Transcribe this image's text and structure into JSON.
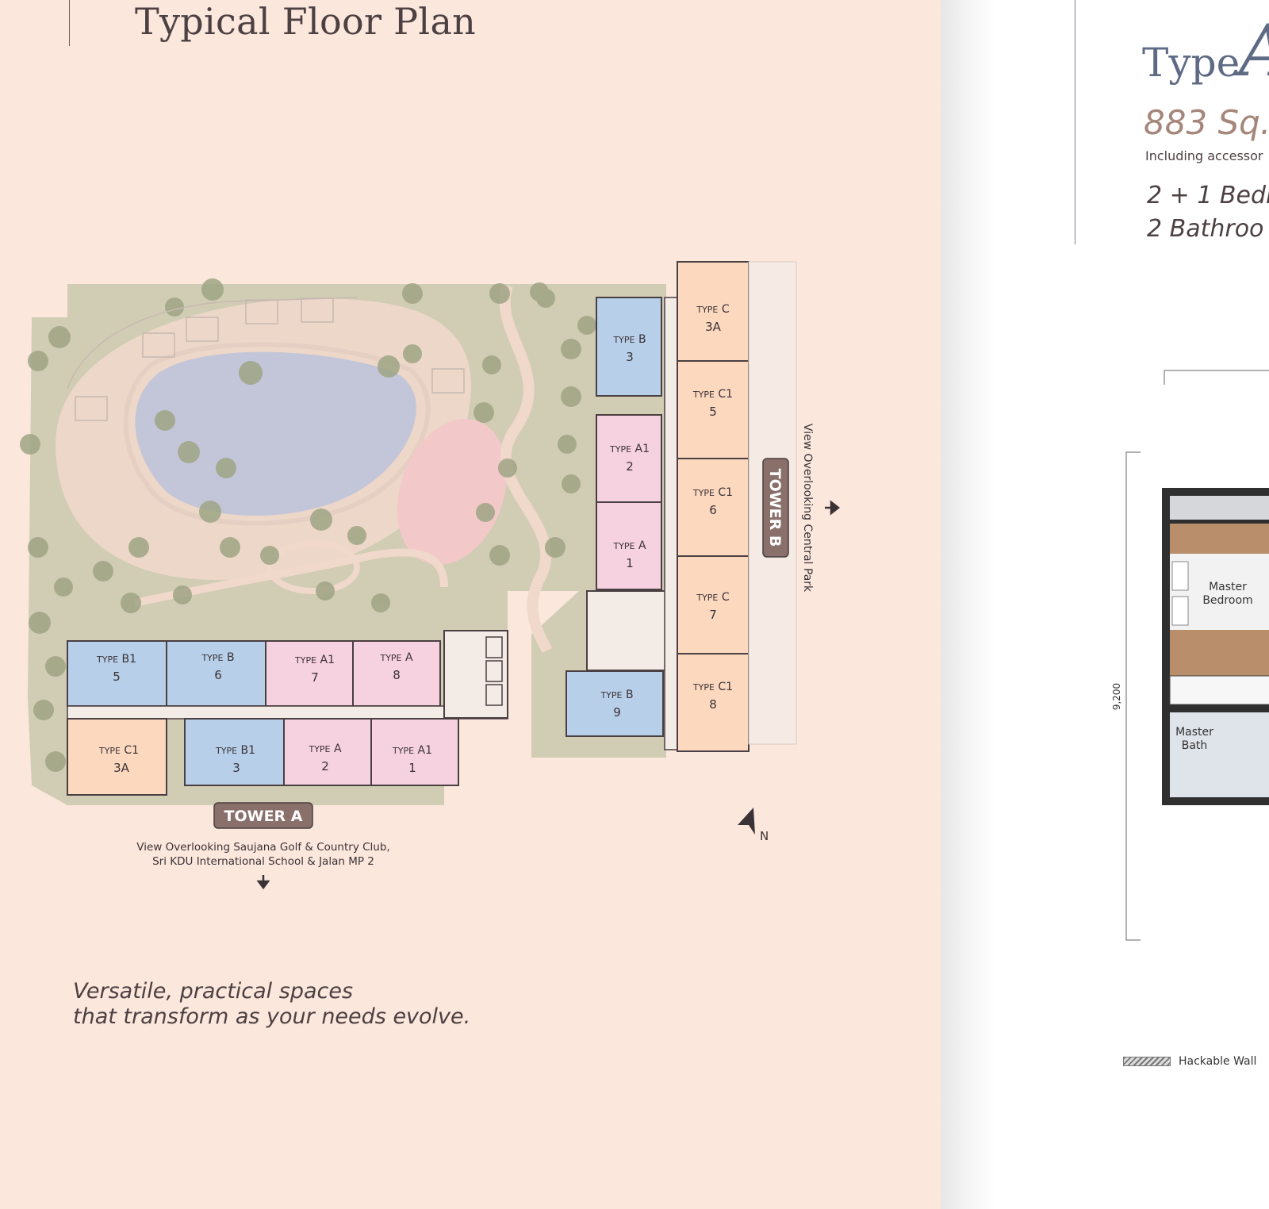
{
  "left_page": {
    "title": "Typical Floor Plan",
    "tagline_line1": "Versatile, practical spaces",
    "tagline_line2": "that transform as your needs evolve."
  },
  "site_plan": {
    "tower_a": {
      "label": "TOWER A",
      "view_line1": "View Overlooking Saujana Golf & Country Club,",
      "view_line2": "Sri KDU International School & Jalan MP 2"
    },
    "tower_b": {
      "label": "TOWER B",
      "view": "View Overlooking Central Park"
    },
    "north_label": "N",
    "units": [
      {
        "type_small": "TYPE",
        "type_big": "C",
        "no": "3A"
      },
      {
        "type_small": "TYPE",
        "type_big": "C1",
        "no": "5"
      },
      {
        "type_small": "TYPE",
        "type_big": "C1",
        "no": "6"
      },
      {
        "type_small": "TYPE",
        "type_big": "C",
        "no": "7"
      },
      {
        "type_small": "TYPE",
        "type_big": "C1",
        "no": "8"
      },
      {
        "type_small": "TYPE",
        "type_big": "B",
        "no": "3"
      },
      {
        "type_small": "TYPE",
        "type_big": "A1",
        "no": "2"
      },
      {
        "type_small": "TYPE",
        "type_big": "A",
        "no": "1"
      },
      {
        "type_small": "TYPE",
        "type_big": "B",
        "no": "9"
      },
      {
        "type_small": "TYPE",
        "type_big": "B1",
        "no": "5"
      },
      {
        "type_small": "TYPE",
        "type_big": "B",
        "no": "6"
      },
      {
        "type_small": "TYPE",
        "type_big": "A1",
        "no": "7"
      },
      {
        "type_small": "TYPE",
        "type_big": "A",
        "no": "8"
      },
      {
        "type_small": "TYPE",
        "type_big": "C1",
        "no": "3A"
      },
      {
        "type_small": "TYPE",
        "type_big": "B1",
        "no": "3"
      },
      {
        "type_small": "TYPE",
        "type_big": "A",
        "no": "2"
      },
      {
        "type_small": "TYPE",
        "type_big": "A1",
        "no": "1"
      }
    ],
    "colors": {
      "type_a": "#f6d1e0",
      "type_b": "#b7cfe9",
      "type_c": "#fcd8bf",
      "landscape": "#c9c7ad",
      "pool": "#c3c6d8"
    }
  },
  "right_page": {
    "type_word": "Type",
    "type_letter": "A",
    "area": "883 Sq.",
    "including": "Including accessor",
    "bedrooms": "2 + 1 Bedr",
    "bathrooms": "2 Bathroo",
    "rooms": {
      "master_bedroom_line1": "Master",
      "master_bedroom_line2": "Bedroom",
      "master_bath_line1": "Master",
      "master_bath_line2": "Bath"
    },
    "dimension": "9,200",
    "legend_hackable": "Hackable Wall"
  }
}
